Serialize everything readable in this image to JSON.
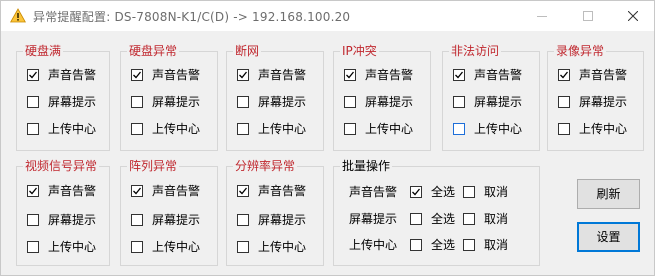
{
  "window": {
    "title": "异常提醒配置: DS-7808N-K1/C(D) -> 192.168.100.20"
  },
  "groups": [
    {
      "title": "硬盘满",
      "items": [
        {
          "label": "声音告警",
          "checked": true
        },
        {
          "label": "屏幕提示",
          "checked": false
        },
        {
          "label": "上传中心",
          "checked": false
        }
      ]
    },
    {
      "title": "硬盘异常",
      "items": [
        {
          "label": "声音告警",
          "checked": true
        },
        {
          "label": "屏幕提示",
          "checked": false
        },
        {
          "label": "上传中心",
          "checked": false
        }
      ]
    },
    {
      "title": "断网",
      "items": [
        {
          "label": "声音告警",
          "checked": true
        },
        {
          "label": "屏幕提示",
          "checked": false
        },
        {
          "label": "上传中心",
          "checked": false
        }
      ]
    },
    {
      "title": "IP冲突",
      "items": [
        {
          "label": "声音告警",
          "checked": true
        },
        {
          "label": "屏幕提示",
          "checked": false
        },
        {
          "label": "上传中心",
          "checked": false
        }
      ]
    },
    {
      "title": "非法访问",
      "items": [
        {
          "label": "声音告警",
          "checked": true
        },
        {
          "label": "屏幕提示",
          "checked": false
        },
        {
          "label": "上传中心",
          "checked": false,
          "focused": true
        }
      ]
    },
    {
      "title": "录像异常",
      "items": [
        {
          "label": "声音告警",
          "checked": true
        },
        {
          "label": "屏幕提示",
          "checked": false
        },
        {
          "label": "上传中心",
          "checked": false
        }
      ]
    },
    {
      "title": "视频信号异常",
      "items": [
        {
          "label": "声音告警",
          "checked": true
        },
        {
          "label": "屏幕提示",
          "checked": false
        },
        {
          "label": "上传中心",
          "checked": false
        }
      ]
    },
    {
      "title": "阵列异常",
      "items": [
        {
          "label": "声音告警",
          "checked": true
        },
        {
          "label": "屏幕提示",
          "checked": false
        },
        {
          "label": "上传中心",
          "checked": false
        }
      ]
    },
    {
      "title": "分辨率异常",
      "items": [
        {
          "label": "声音告警",
          "checked": true
        },
        {
          "label": "屏幕提示",
          "checked": false
        },
        {
          "label": "上传中心",
          "checked": false
        }
      ]
    }
  ],
  "batch": {
    "title": "批量操作",
    "rows": [
      {
        "label": "声音告警",
        "select_all": "全选",
        "select_all_checked": true,
        "cancel": "取消",
        "cancel_checked": false
      },
      {
        "label": "屏幕提示",
        "select_all": "全选",
        "select_all_checked": false,
        "cancel": "取消",
        "cancel_checked": false
      },
      {
        "label": "上传中心",
        "select_all": "全选",
        "select_all_checked": false,
        "cancel": "取消",
        "cancel_checked": false
      }
    ]
  },
  "buttons": {
    "refresh": "刷新",
    "settings": "设置"
  },
  "colors": {
    "group_title": "#c0282f",
    "focus_border": "#0078d7",
    "warning_icon": "#f0a30a"
  }
}
